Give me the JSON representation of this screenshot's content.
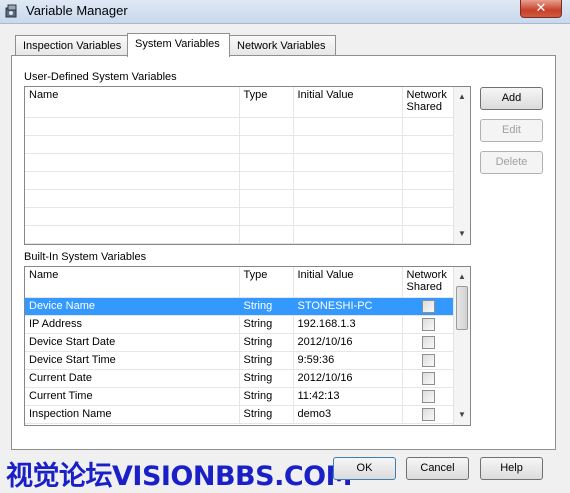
{
  "window": {
    "title": "Variable Manager",
    "close_glyph": "✕",
    "icon": "variable-manager-icon"
  },
  "tabs": [
    {
      "label": "Inspection Variables",
      "active": false
    },
    {
      "label": "System Variables",
      "active": true
    },
    {
      "label": "Network Variables",
      "active": false
    }
  ],
  "user_defined": {
    "label": "User-Defined System Variables",
    "columns": [
      "Name",
      "Type",
      "Initial Value",
      "Network Shared"
    ],
    "rows": []
  },
  "built_in": {
    "label": "Built-In System Variables",
    "columns": [
      "Name",
      "Type",
      "Initial Value",
      "Network Shared"
    ],
    "rows": [
      {
        "name": "Device Name",
        "type": "String",
        "value": "STONESHI-PC",
        "shared": false,
        "selected": true
      },
      {
        "name": "IP Address",
        "type": "String",
        "value": "192.168.1.3",
        "shared": false,
        "selected": false
      },
      {
        "name": "Device Start Date",
        "type": "String",
        "value": "2012/10/16",
        "shared": false,
        "selected": false
      },
      {
        "name": "Device Start Time",
        "type": "String",
        "value": "9:59:36",
        "shared": false,
        "selected": false
      },
      {
        "name": "Current Date",
        "type": "String",
        "value": "2012/10/16",
        "shared": false,
        "selected": false
      },
      {
        "name": "Current Time",
        "type": "String",
        "value": "11:42:13",
        "shared": false,
        "selected": false
      },
      {
        "name": "Inspection Name",
        "type": "String",
        "value": "demo3",
        "shared": false,
        "selected": false
      }
    ]
  },
  "side_buttons": {
    "add": {
      "label": "Add",
      "enabled": true
    },
    "edit": {
      "label": "Edit",
      "enabled": false
    },
    "delete": {
      "label": "Delete",
      "enabled": false
    }
  },
  "footer": {
    "ok": "OK",
    "cancel": "Cancel",
    "help": "Help"
  },
  "watermark": "视觉论坛VISIONBBS.COM",
  "colors": {
    "selection": "#3399ff",
    "watermark": "#1a20c8"
  }
}
